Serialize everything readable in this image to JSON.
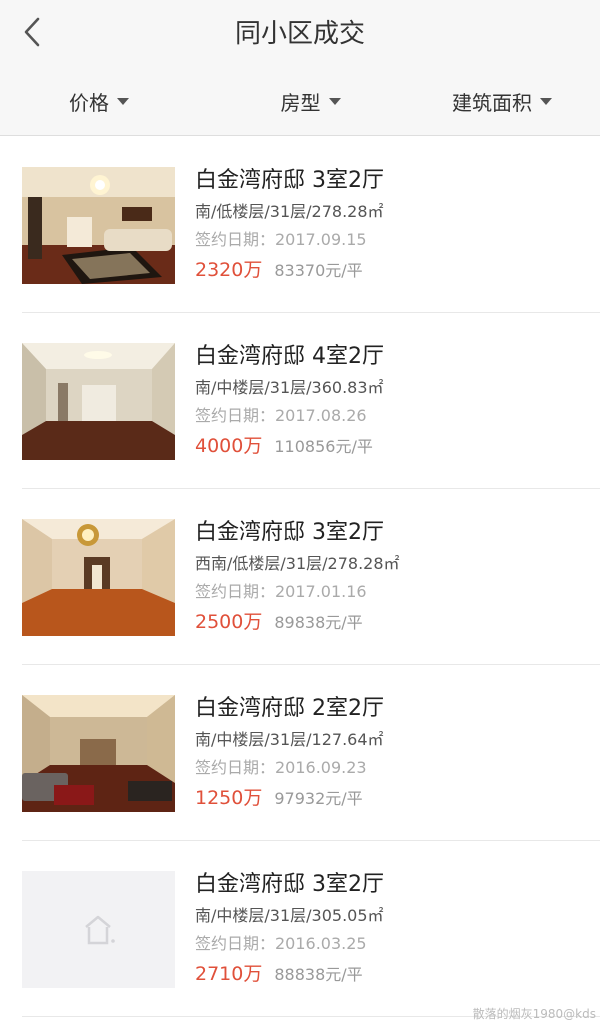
{
  "header": {
    "title": "同小区成交"
  },
  "filters": [
    {
      "label": "价格"
    },
    {
      "label": "房型"
    },
    {
      "label": "建筑面积"
    }
  ],
  "listings": [
    {
      "title": "白金湾府邸 3室2厅",
      "attrs": "南/低楼层/31层/278.28㎡",
      "date": "签约日期：2017.09.15",
      "price": "2320万",
      "unit_price": "83370元/平",
      "photo": "living-room-chandelier"
    },
    {
      "title": "白金湾府邸 4室2厅",
      "attrs": "南/中楼层/31层/360.83㎡",
      "date": "签约日期：2017.08.26",
      "price": "4000万",
      "unit_price": "110856元/平",
      "photo": "empty-room"
    },
    {
      "title": "白金湾府邸 3室2厅",
      "attrs": "西南/低楼层/31层/278.28㎡",
      "date": "签约日期：2017.01.16",
      "price": "2500万",
      "unit_price": "89838元/平",
      "photo": "hallway-chandelier"
    },
    {
      "title": "白金湾府邸 2室2厅",
      "attrs": "南/中楼层/31层/127.64㎡",
      "date": "签约日期：2016.09.23",
      "price": "1250万",
      "unit_price": "97932元/平",
      "photo": "living-room-sofa"
    },
    {
      "title": "白金湾府邸 3室2厅",
      "attrs": "南/中楼层/31层/305.05㎡",
      "date": "签约日期：2016.03.25",
      "price": "2710万",
      "unit_price": "88838元/平",
      "photo": "placeholder"
    }
  ],
  "watermark": "散落的烟灰1980@kds",
  "colors": {
    "price": "#e0503a",
    "header_bg": "#f7f7f7"
  }
}
